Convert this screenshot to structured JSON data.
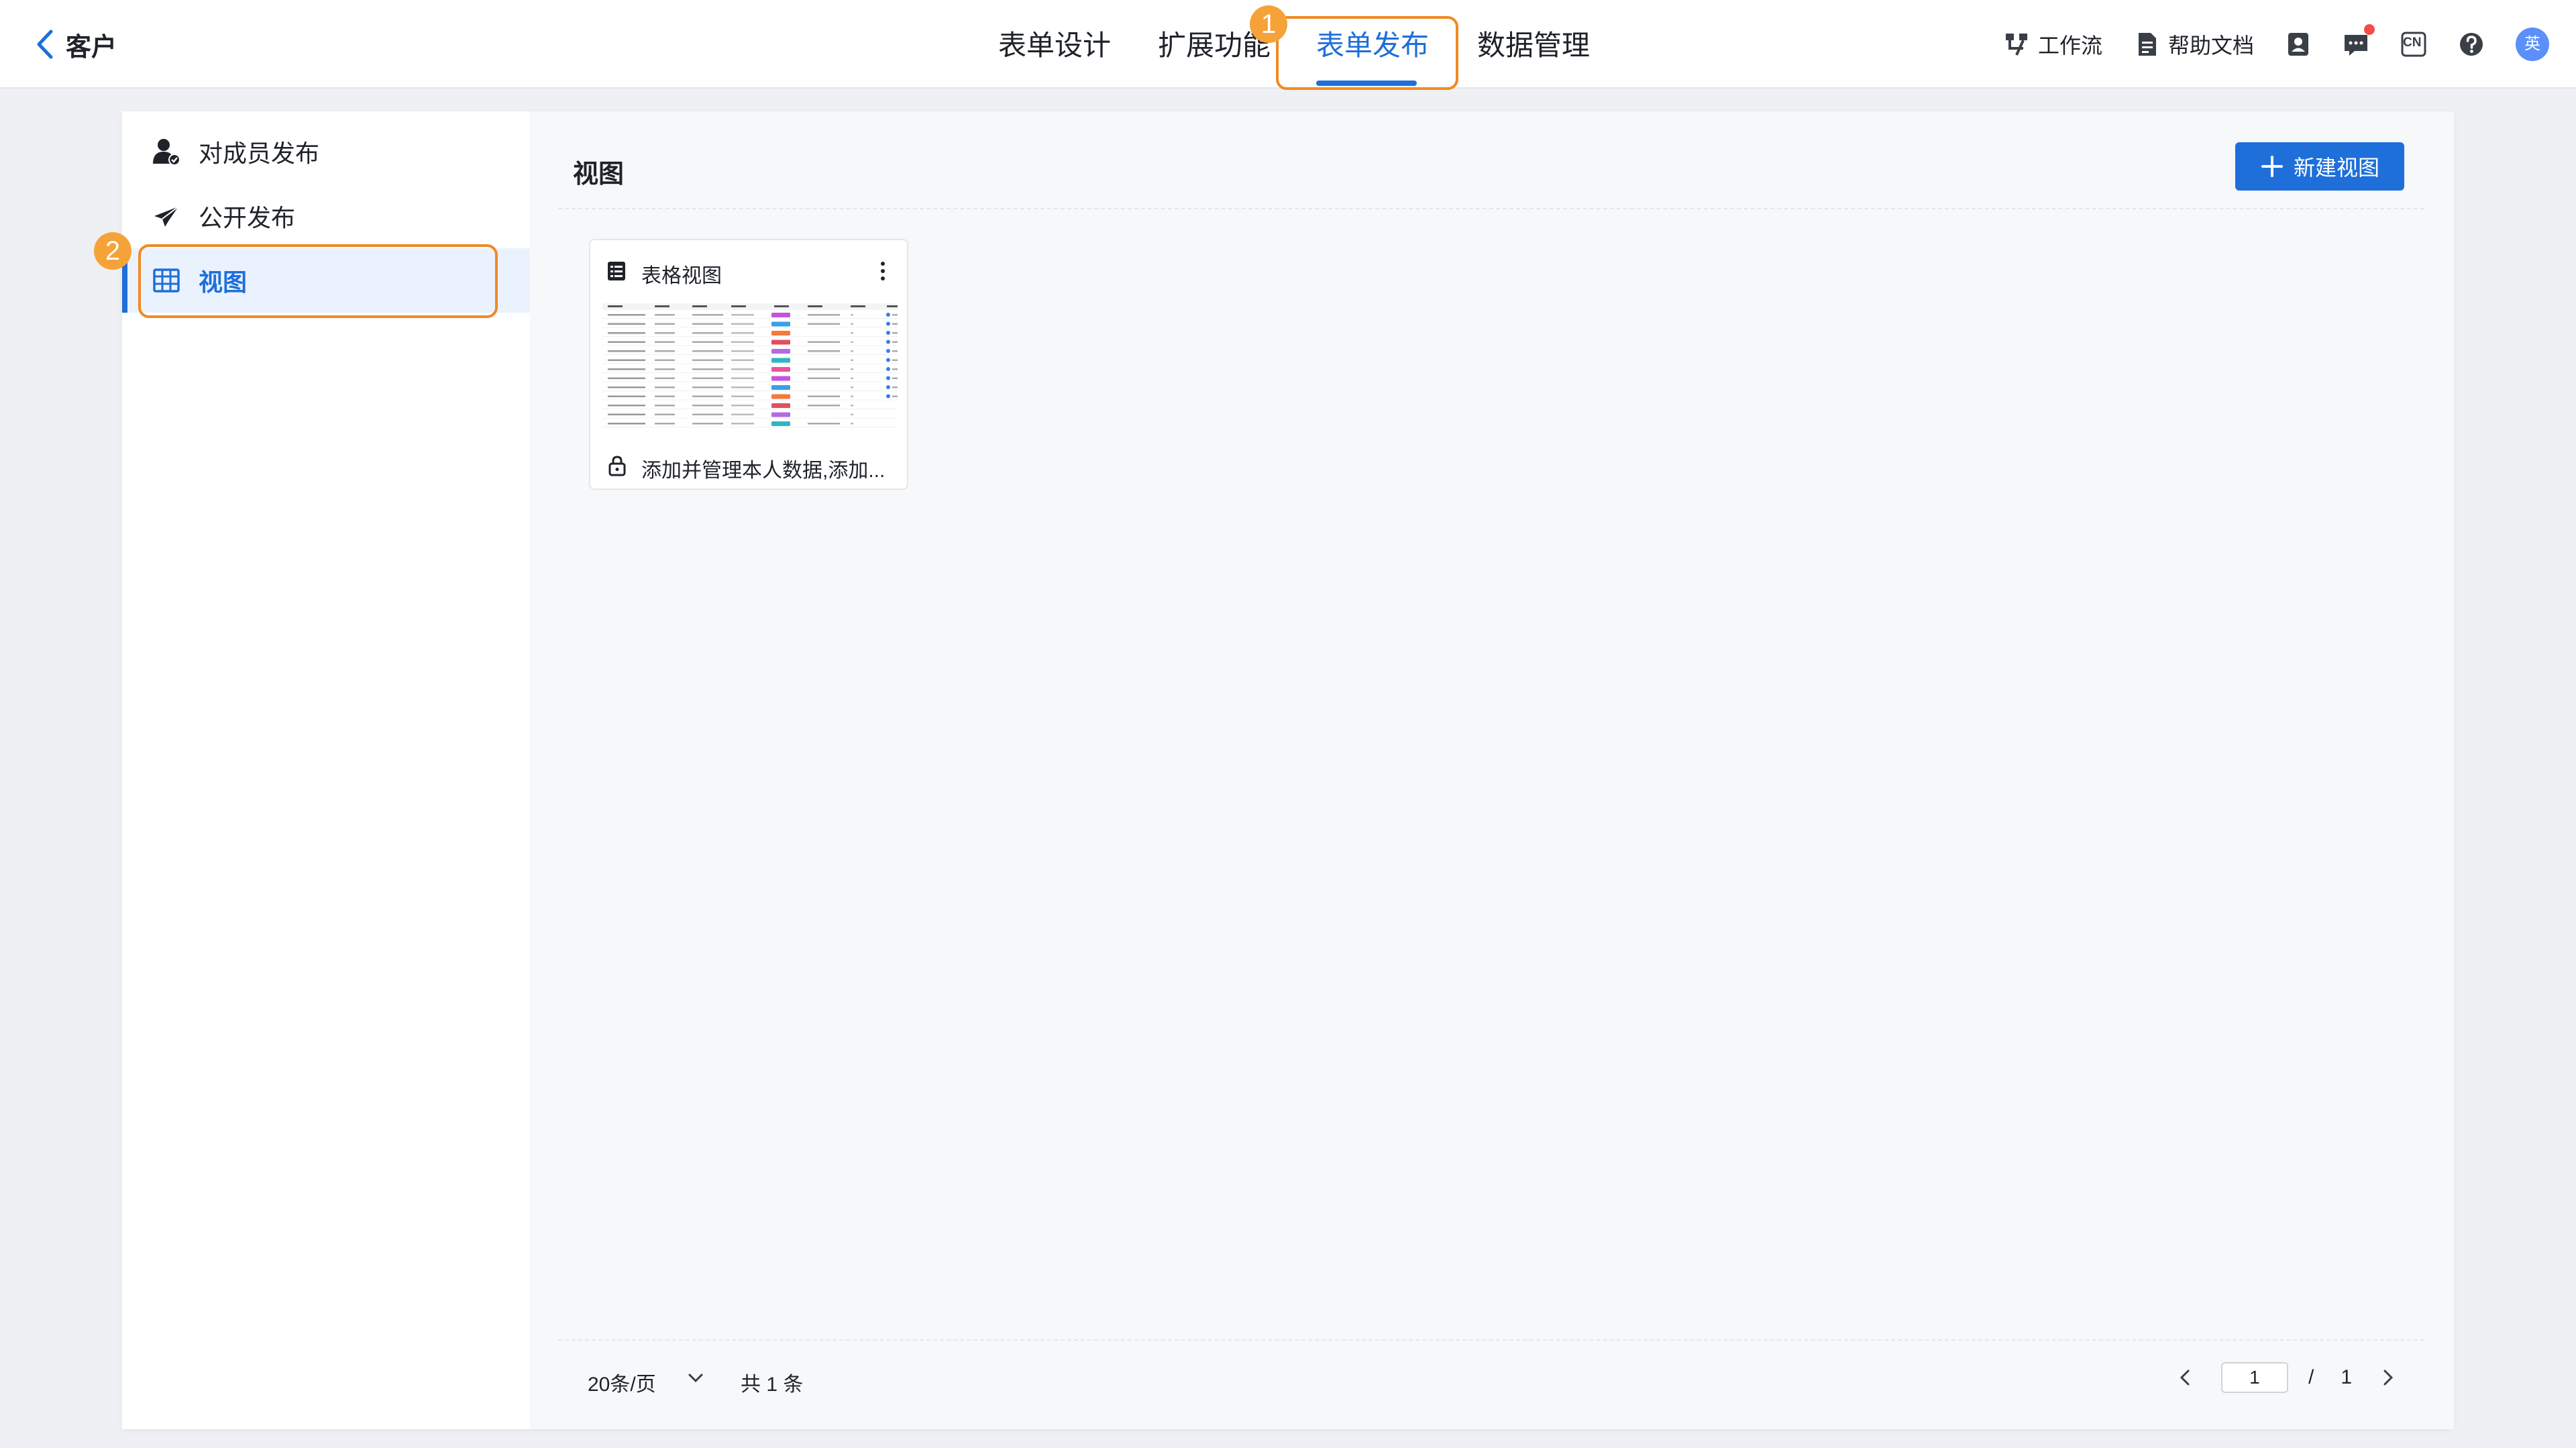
{
  "header": {
    "back_title": "客户",
    "tabs": [
      {
        "label": "表单设计"
      },
      {
        "label": "扩展功能"
      },
      {
        "label": "表单发布"
      },
      {
        "label": "数据管理"
      }
    ],
    "active_tab": "表单发布",
    "step_badge_1": "1",
    "tools": {
      "workflow_label": "工作流",
      "help_label": "帮助文档",
      "lang_label": "CN",
      "avatar_text": "英"
    }
  },
  "sidebar": {
    "items": [
      {
        "label": "对成员发布",
        "icon": "member-publish-icon"
      },
      {
        "label": "公开发布",
        "icon": "paper-plane-icon"
      },
      {
        "label": "视图",
        "icon": "table-grid-icon"
      }
    ],
    "active_item": "视图",
    "step_badge_2": "2"
  },
  "content": {
    "title": "视图",
    "new_button_label": "新建视图",
    "cards": [
      {
        "name": "表格视图",
        "description": "添加并管理本人数据,添加..."
      }
    ]
  },
  "pagination": {
    "page_size_label": "20条/页",
    "total_label": "共 1 条",
    "current_page": "1",
    "separator": "/",
    "total_pages": "1"
  },
  "colors": {
    "accent": "#1e6fd9",
    "highlight": "#f08a24",
    "badge": "#f5a338",
    "notification": "#f54a45"
  }
}
